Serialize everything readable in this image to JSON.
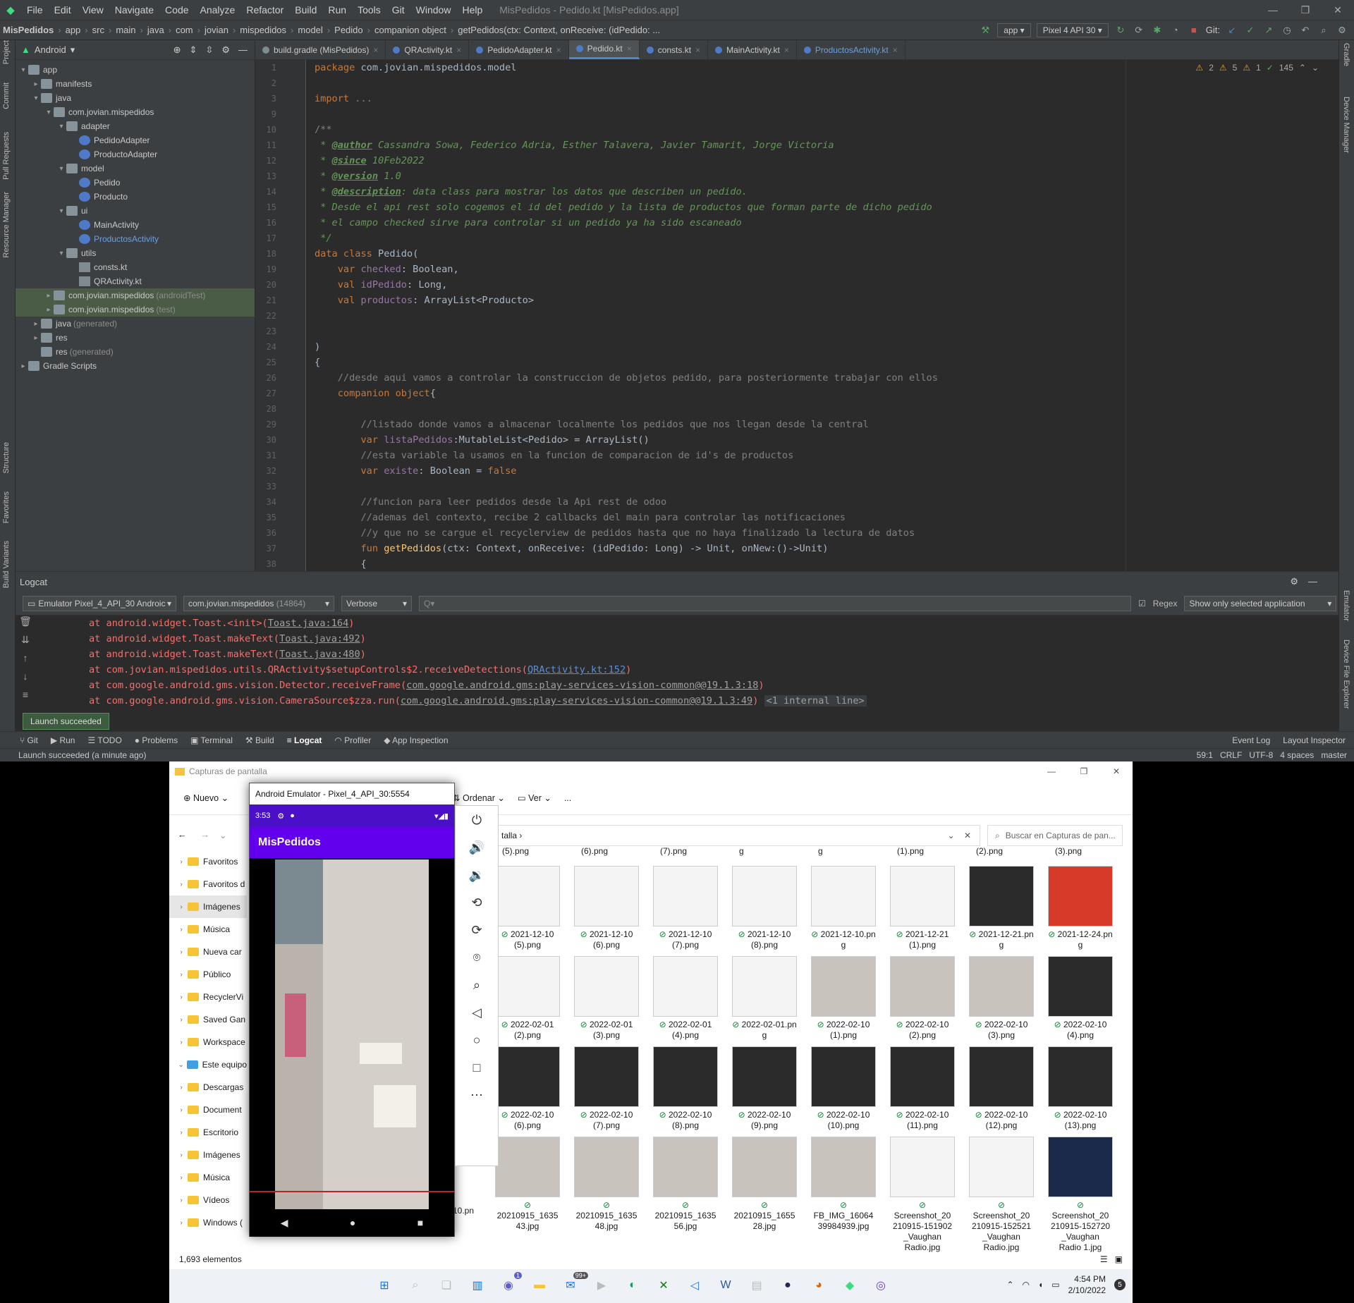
{
  "ide": {
    "menu": [
      "File",
      "Edit",
      "View",
      "Navigate",
      "Code",
      "Analyze",
      "Refactor",
      "Build",
      "Run",
      "Tools",
      "Git",
      "Window",
      "Help"
    ],
    "window_title": "MisPedidos - Pedido.kt [MisPedidos.app]",
    "breadcrumbs": [
      "MisPedidos",
      "app",
      "src",
      "main",
      "java",
      "com",
      "jovian",
      "mispedidos",
      "model",
      "Pedido",
      "companion object",
      "getPedidos(ctx: Context, onReceive: (idPedido: ..."
    ],
    "run_config": "app",
    "device": "Pixel 4 API 30",
    "git_label": "Git:",
    "left_labels": [
      "Project",
      "Commit",
      "Pull Requests",
      "Resource Manager",
      "Structure",
      "Favorites",
      "Build Variants"
    ],
    "right_labels": [
      "Gradle",
      "Device Manager",
      "Emulator",
      "Device File Explorer"
    ],
    "project_view": "Android",
    "tree": [
      {
        "label": "app",
        "indent": 0,
        "arrow": "▾",
        "icon": "fold"
      },
      {
        "label": "manifests",
        "indent": 1,
        "arrow": "▸",
        "icon": "fold"
      },
      {
        "label": "java",
        "indent": 1,
        "arrow": "▾",
        "icon": "fold"
      },
      {
        "label": "com.jovian.mispedidos",
        "indent": 2,
        "arrow": "▾",
        "icon": "fold"
      },
      {
        "label": "adapter",
        "indent": 3,
        "arrow": "▾",
        "icon": "fold"
      },
      {
        "label": "PedidoAdapter",
        "indent": 4,
        "arrow": "",
        "icon": "kt"
      },
      {
        "label": "ProductoAdapter",
        "indent": 4,
        "arrow": "",
        "icon": "kt"
      },
      {
        "label": "model",
        "indent": 3,
        "arrow": "▾",
        "icon": "fold"
      },
      {
        "label": "Pedido",
        "indent": 4,
        "arrow": "",
        "icon": "kt"
      },
      {
        "label": "Producto",
        "indent": 4,
        "arrow": "",
        "icon": "kt"
      },
      {
        "label": "ui",
        "indent": 3,
        "arrow": "▾",
        "icon": "fold"
      },
      {
        "label": "MainActivity",
        "indent": 4,
        "arrow": "",
        "icon": "kt"
      },
      {
        "label": "ProductosActivity",
        "indent": 4,
        "arrow": "",
        "icon": "kt",
        "active": true
      },
      {
        "label": "utils",
        "indent": 3,
        "arrow": "▾",
        "icon": "fold"
      },
      {
        "label": "consts.kt",
        "indent": 4,
        "arrow": "",
        "icon": "ktf"
      },
      {
        "label": "QRActivity.kt",
        "indent": 4,
        "arrow": "",
        "icon": "ktf"
      },
      {
        "label": "com.jovian.mispedidos",
        "suffix": "(androidTest)",
        "indent": 2,
        "arrow": "▸",
        "icon": "fold",
        "sel": true
      },
      {
        "label": "com.jovian.mispedidos",
        "suffix": "(test)",
        "indent": 2,
        "arrow": "▸",
        "icon": "fold",
        "sel": true
      },
      {
        "label": "java",
        "suffix": "(generated)",
        "indent": 1,
        "arrow": "▸",
        "icon": "fold"
      },
      {
        "label": "res",
        "indent": 1,
        "arrow": "▸",
        "icon": "fold"
      },
      {
        "label": "res",
        "suffix": "(generated)",
        "indent": 1,
        "arrow": "",
        "icon": "fold"
      },
      {
        "label": "Gradle Scripts",
        "indent": 0,
        "arrow": "▸",
        "icon": "fold"
      }
    ],
    "tabs": [
      "build.gradle (MisPedidos)",
      "QRActivity.kt",
      "PedidoAdapter.kt",
      "Pedido.kt",
      "consts.kt",
      "MainActivity.kt",
      "ProductosActivity.kt"
    ],
    "active_tab": 3,
    "inspections": {
      "warn1": "2",
      "warn2": "5",
      "weak": "1",
      "ok": "145"
    },
    "code_lines": [
      [
        [
          "kw",
          "package "
        ],
        [
          "",
          "com.jovian.mispedidos.model"
        ]
      ],
      [],
      [
        [
          "kw",
          "import "
        ],
        [
          "cm",
          "..."
        ]
      ],
      [],
      [
        [
          "cm",
          "/**"
        ]
      ],
      [
        [
          "dc",
          " * "
        ],
        [
          "ds",
          "@author"
        ],
        [
          "dc",
          " Cassandra Sowa, Federico Adria, Esther Talavera, Javier Tamarit, Jorge Victoria"
        ]
      ],
      [
        [
          "dc",
          " * "
        ],
        [
          "ds",
          "@since"
        ],
        [
          "dc",
          " 10Feb2022"
        ]
      ],
      [
        [
          "dc",
          " * "
        ],
        [
          "ds",
          "@version"
        ],
        [
          "dc",
          " 1.0"
        ]
      ],
      [
        [
          "dc",
          " * "
        ],
        [
          "ds",
          "@description"
        ],
        [
          "dc",
          ": data class para mostrar los datos que describen un pedido."
        ]
      ],
      [
        [
          "dc",
          " * Desde el api rest solo cogemos el id del pedido y la lista de productos que forman parte de dicho pedido"
        ]
      ],
      [
        [
          "dc",
          " * el campo checked sirve para controlar si un pedido ya ha sido escaneado"
        ]
      ],
      [
        [
          "dc",
          " */"
        ]
      ],
      [
        [
          "kw",
          "data class "
        ],
        [
          "",
          "Pedido("
        ]
      ],
      [
        [
          "kw",
          "    var "
        ],
        [
          "pp",
          "checked"
        ],
        [
          "",
          ": Boolean,"
        ]
      ],
      [
        [
          "kw",
          "    val "
        ],
        [
          "pp",
          "idPedido"
        ],
        [
          "",
          ": Long,"
        ]
      ],
      [
        [
          "kw",
          "    val "
        ],
        [
          "pp",
          "productos"
        ],
        [
          "",
          ": ArrayList<Producto>"
        ]
      ],
      [],
      [],
      [
        [
          "",
          ")"
        ]
      ],
      [
        [
          "",
          "{"
        ]
      ],
      [
        [
          "cm",
          "    //desde aqui vamos a controlar la construccion de objetos pedido, para posteriormente trabajar con ellos"
        ]
      ],
      [
        [
          "kw",
          "    companion object"
        ],
        [
          "",
          "{"
        ]
      ],
      [],
      [
        [
          "cm",
          "        //listado donde vamos a almacenar localmente los pedidos que nos llegan desde la central"
        ]
      ],
      [
        [
          "kw",
          "        var "
        ],
        [
          "pp",
          "listaPedidos"
        ],
        [
          "",
          ":MutableList<Pedido> = ArrayList()"
        ]
      ],
      [
        [
          "cm",
          "        //esta variable la usamos en la funcion de comparacion de id's de productos"
        ]
      ],
      [
        [
          "kw",
          "        var "
        ],
        [
          "pp",
          "existe"
        ],
        [
          "",
          ": Boolean = "
        ],
        [
          "kw",
          "false"
        ]
      ],
      [],
      [
        [
          "cm",
          "        //funcion para leer pedidos desde la Api rest de odoo"
        ]
      ],
      [
        [
          "cm",
          "        //ademas del contexto, recibe 2 callbacks del main para controlar las notificaciones"
        ]
      ],
      [
        [
          "cm",
          "        //y que no se cargue el recyclerview de pedidos hasta que no haya finalizado la lectura de datos"
        ]
      ],
      [
        [
          "kw",
          "        fun "
        ],
        [
          "fn",
          "getPedidos"
        ],
        [
          "",
          "(ctx: Context, onReceive: (idPedido: Long) -> Unit, onNew:()->Unit)"
        ]
      ],
      [
        [
          "",
          "        {"
        ]
      ]
    ],
    "line_numbers": [
      "1",
      "2",
      "3",
      "9",
      "10",
      "11",
      "12",
      "13",
      "14",
      "15",
      "16",
      "17",
      "18",
      "19",
      "20",
      "21",
      "22",
      "23",
      "24",
      "25",
      "26",
      "27",
      "28",
      "29",
      "30",
      "31",
      "32",
      "33",
      "34",
      "35",
      "36",
      "37",
      "38"
    ],
    "logcat": {
      "title": "Logcat",
      "device": "Emulator Pixel_4_API_30 Androic",
      "package": "com.jovian.mispedidos",
      "pid": "(14864)",
      "level": "Verbose",
      "search_placeholder": "Q▾",
      "regex_label": "Regex",
      "filter": "Show only selected application",
      "lines": [
        [
          [
            "",
            "at android.widget.Toast.<init>("
          ],
          [
            "lnk2",
            "Toast.java:164"
          ],
          [
            "",
            ")"
          ]
        ],
        [
          [
            "",
            "at android.widget.Toast.makeText("
          ],
          [
            "lnk2",
            "Toast.java:492"
          ],
          [
            "",
            ")"
          ]
        ],
        [
          [
            "",
            "at android.widget.Toast.makeText("
          ],
          [
            "lnk2",
            "Toast.java:480"
          ],
          [
            "",
            ")"
          ]
        ],
        [
          [
            "",
            "at com.jovian.mispedidos.utils.QRActivity$setupControls$2.receiveDetections("
          ],
          [
            "lnk",
            "QRActivity.kt:152"
          ],
          [
            "",
            ")"
          ]
        ],
        [
          [
            "",
            "at com.google.android.gms.vision.Detector.receiveFrame("
          ],
          [
            "lnk2",
            "com.google.android.gms:play-services-vision-common@@19.1.3:18"
          ],
          [
            "",
            ")"
          ]
        ],
        [
          [
            "",
            "at com.google.android.gms.vision.CameraSource$zza.run("
          ],
          [
            "lnk2",
            "com.google.android.gms:play-services-vision-common@@19.1.3:49"
          ],
          [
            "",
            ") "
          ],
          [
            "pill",
            "<1 internal line>"
          ]
        ]
      ]
    },
    "toast": "Launch succeeded",
    "bottom_tools": [
      "Git",
      "Run",
      "TODO",
      "Problems",
      "Terminal",
      "Build",
      "Logcat",
      "Profiler",
      "App Inspection"
    ],
    "bottom_right": [
      "Event Log",
      "Layout Inspector"
    ],
    "status_left": "Launch succeeded (a minute ago)",
    "status_right": [
      "59:1",
      "CRLF",
      "UTF-8",
      "4 spaces",
      "master"
    ]
  },
  "explorer": {
    "title": "Capturas de pantalla",
    "cmd": [
      "Nuevo",
      "Ordenar",
      "Ver",
      "..."
    ],
    "address": "talla  ›",
    "search_placeholder": "Buscar en Capturas de pan...",
    "nav": [
      {
        "label": "Favoritos",
        "arrow": "›"
      },
      {
        "label": "Favoritos d",
        "arrow": "›"
      },
      {
        "label": "Imágenes",
        "arrow": "›",
        "sel": true
      },
      {
        "label": "Música",
        "arrow": "›"
      },
      {
        "label": "Nueva car",
        "arrow": "›"
      },
      {
        "label": "Público",
        "arrow": "›"
      },
      {
        "label": "RecyclerVi",
        "arrow": "›"
      },
      {
        "label": "Saved Gan",
        "arrow": "›"
      },
      {
        "label": "Workspace",
        "arrow": "›"
      },
      {
        "label": "Este equipo",
        "arrow": "⌄",
        "pc": true
      },
      {
        "label": "Descargas",
        "arrow": "›"
      },
      {
        "label": "Document",
        "arrow": "›"
      },
      {
        "label": "Escritorio",
        "arrow": "›"
      },
      {
        "label": "Imágenes",
        "arrow": "›"
      },
      {
        "label": "Música",
        "arrow": "›"
      },
      {
        "label": "Vídeos",
        "arrow": "›"
      },
      {
        "label": "Windows (",
        "arrow": "›"
      }
    ],
    "top_labels": [
      "(5).png",
      "(6).png",
      "(7).png",
      "g",
      "g",
      "(1).png",
      "(2).png",
      "(3).png"
    ],
    "items": [
      {
        "name": "2021-12-10\n(5).png",
        "t": "shot"
      },
      {
        "name": "2021-12-10\n(6).png",
        "t": "shot"
      },
      {
        "name": "2021-12-10\n(7).png",
        "t": "shot"
      },
      {
        "name": "2021-12-10\n(8).png",
        "t": "shot"
      },
      {
        "name": "2021-12-10.pn\ng",
        "t": "shot"
      },
      {
        "name": "2021-12-21\n(1).png",
        "t": "shot"
      },
      {
        "name": "2021-12-21.pn\ng",
        "t": "dark"
      },
      {
        "name": "2021-12-24.pn\ng",
        "t": "tree"
      },
      {
        "name": "2022-02-01\n(2).png",
        "t": "shot"
      },
      {
        "name": "2022-02-01\n(3).png",
        "t": "shot"
      },
      {
        "name": "2022-02-01\n(4).png",
        "t": "shot"
      },
      {
        "name": "2022-02-01.pn\ng",
        "t": "shot"
      },
      {
        "name": "2022-02-10\n(1).png",
        "t": "photo"
      },
      {
        "name": "2022-02-10\n(2).png",
        "t": "photo"
      },
      {
        "name": "2022-02-10\n(3).png",
        "t": "photo"
      },
      {
        "name": "2022-02-10\n(4).png",
        "t": "dark"
      },
      {
        "name": "2022-02-10\n(6).png",
        "t": "dark"
      },
      {
        "name": "2022-02-10\n(7).png",
        "t": "dark"
      },
      {
        "name": "2022-02-10\n(8).png",
        "t": "dark"
      },
      {
        "name": "2022-02-10\n(9).png",
        "t": "dark"
      },
      {
        "name": "2022-02-10\n(10).png",
        "t": "dark"
      },
      {
        "name": "2022-02-10\n(11).png",
        "t": "dark"
      },
      {
        "name": "2022-02-10\n(12).png",
        "t": "dark"
      },
      {
        "name": "2022-02-10\n(13).png",
        "t": "dark"
      },
      {
        "name": "20210915_1635\n43.jpg",
        "t": "photo"
      },
      {
        "name": "20210915_1635\n48.jpg",
        "t": "photo"
      },
      {
        "name": "20210915_1635\n56.jpg",
        "t": "photo"
      },
      {
        "name": "20210915_1655\n28.jpg",
        "t": "photo"
      },
      {
        "name": "FB_IMG_16064\n39984939.jpg",
        "t": "photo"
      },
      {
        "name": "Screenshot_20\n210915-151902\n_Vaughan\nRadio.jpg",
        "t": "shot"
      },
      {
        "name": "Screenshot_20\n210915-152521\n_Vaughan\nRadio.jpg",
        "t": "shot"
      },
      {
        "name": "Screenshot_20\n210915-152720\n_Vaughan\nRadio 1.jpg",
        "t": "blue"
      }
    ],
    "partial_label": "10.pn",
    "count": "1,693 elementos"
  },
  "emulator": {
    "title": "Android Emulator - Pixel_4_API_30:5554",
    "time": "3:53",
    "app_title": "MisPedidos"
  },
  "taskbar": {
    "time": "4:54 PM",
    "date": "2/10/2022",
    "notif": "5",
    "mail_badge": "99+",
    "teams_badge": "1"
  }
}
